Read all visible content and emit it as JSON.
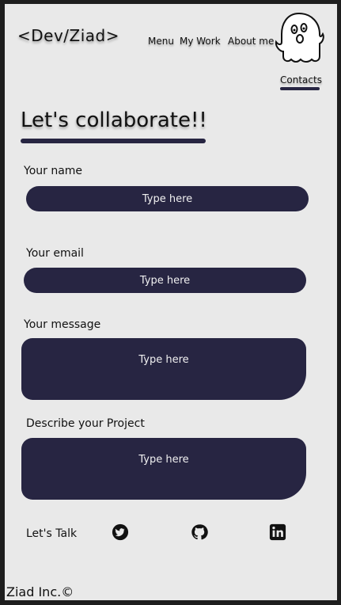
{
  "header": {
    "logo": "<Dev/Ziad>",
    "nav": [
      "Menu",
      "My Work",
      "About me"
    ],
    "active_nav": "Contacts"
  },
  "form": {
    "title": "Let's collaborate!!",
    "fields": [
      {
        "label": "Your name",
        "placeholder": "Type here"
      },
      {
        "label": "Your email",
        "placeholder": "Type here"
      },
      {
        "label": "Your message",
        "placeholder": "Type here"
      },
      {
        "label": "Describe your Project",
        "placeholder": "Type here"
      }
    ]
  },
  "social": {
    "label": "Let's Talk",
    "icons": [
      "twitter-icon",
      "github-icon",
      "linkedin-icon"
    ]
  },
  "footer": {
    "text": "Ziad Inc.©"
  },
  "colors": {
    "accent": "#272542",
    "background": "#e9e9e9"
  }
}
